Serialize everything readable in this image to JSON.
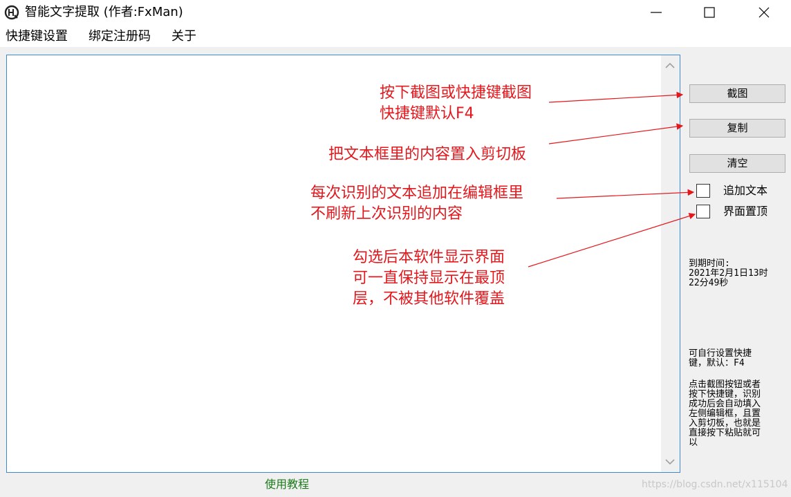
{
  "window": {
    "title": "智能文字提取 (作者:FxMan)",
    "minimize_icon": "minimize-icon",
    "maximize_icon": "maximize-icon",
    "close_icon": "close-icon"
  },
  "menu": {
    "items": [
      "快捷键设置",
      "绑定注册码",
      "关于"
    ]
  },
  "editor": {
    "content": ""
  },
  "buttons": {
    "screenshot": "截图",
    "copy": "复制",
    "clear": "清空"
  },
  "options": {
    "append_text": {
      "label": "追加文本",
      "checked": false
    },
    "always_on_top": {
      "label": "界面置顶",
      "checked": false
    }
  },
  "expiry": {
    "label": "到期时间:",
    "value_line1": "2021年2月1日13时",
    "value_line2": "22分49秒"
  },
  "help": {
    "hotkey_line1": "可自行设置快捷",
    "hotkey_line2": "键，默认：F4",
    "usage_lines": [
      "点击截图按钮或者",
      "按下快捷键，识别",
      "成功后会自动填入",
      "左侧编辑框，且置",
      "入剪切板，也就是",
      "直接按下粘贴就可",
      "以"
    ]
  },
  "footer": {
    "tutorial_link": "使用教程",
    "watermark": "https://blog.csdn.net/x115104"
  },
  "annotations": {
    "screenshot_line1": "按下截图或快捷键截图",
    "screenshot_line2": "快捷键默认F4",
    "copy": "把文本框里的内容置入剪切板",
    "append_line1": "每次识别的文本追加在编辑框里",
    "append_line2": "不刷新上次识别的内容",
    "ontop_line1": "勾选后本软件显示界面",
    "ontop_line2": "可一直保持显示在最顶",
    "ontop_line3": "层，不被其他软件覆盖"
  },
  "colors": {
    "annotation": "#e3171c",
    "link": "#1a7a1a",
    "focus_border": "#3c8ad6"
  }
}
